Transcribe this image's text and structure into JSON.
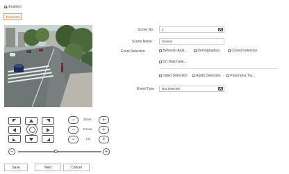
{
  "header": {
    "enabled_label": "Enabled",
    "enabled_checked": true,
    "event_set_label": "Event Set"
  },
  "form": {
    "scene_no_label": "Scene No.",
    "scene_no_value": "2",
    "scene_name_label": "Scene Name",
    "scene_name_value": "Scene2",
    "event_selection_label": "Event Selection",
    "events": [
      {
        "label": "Behavior Anal...",
        "checked": false
      },
      {
        "label": "Demographics",
        "checked": false
      },
      {
        "label": "Crowd Detection",
        "checked": false
      },
      {
        "label": "On Duty Dete...",
        "checked": false
      },
      {
        "label": "Video Detection",
        "checked": false
      },
      {
        "label": "Audio Detection",
        "checked": false
      },
      {
        "label": "Panorama Tra...",
        "checked": false
      }
    ],
    "event_type_label": "Event Type",
    "event_type_value": "Not Selected"
  },
  "ptz": {
    "zoom_label": "Zoom",
    "focus_label": "Focus",
    "iris_label": "Iris",
    "minus_symbol": "−",
    "plus_symbol": "+",
    "speed_fraction": 0.45
  },
  "footer": {
    "save_label": "Save",
    "next_label": "Next",
    "cancel_label": "Cancel"
  }
}
